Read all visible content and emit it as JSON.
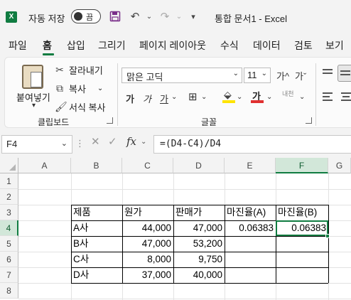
{
  "titlebar": {
    "app_logo": "X",
    "autosave_label": "자동 저장",
    "autosave_state": "끔",
    "save_icon": "save-icon",
    "undo_icon": "undo-icon",
    "redo_icon": "redo-icon",
    "customize_icon": "customize-qat-icon",
    "doc_title": "통합 문서1 - Excel"
  },
  "tabs": [
    {
      "label": "파일"
    },
    {
      "label": "홈"
    },
    {
      "label": "삽입"
    },
    {
      "label": "그리기"
    },
    {
      "label": "페이지 레이아웃"
    },
    {
      "label": "수식"
    },
    {
      "label": "데이터"
    },
    {
      "label": "검토"
    },
    {
      "label": "보기"
    }
  ],
  "clipboard": {
    "paste_label": "붙여넣기",
    "cut_label": "잘라내기",
    "copy_label": "복사",
    "format_painter_label": "서식 복사",
    "group_label": "클립보드"
  },
  "font": {
    "name": "맑은 고딕",
    "size": "11",
    "grow_label": "가^",
    "shrink_label": "가ˇ",
    "bold_label": "가",
    "italic_label": "가",
    "underline_label": "가",
    "color_label": "가",
    "phonetic_label": "내천",
    "group_label": "글꼴",
    "font_color_hex": "#e03030",
    "fill_color_hex": "#ffe400"
  },
  "formula_bar": {
    "name_box": "F4",
    "cancel_icon": "cancel-icon",
    "enter_icon": "enter-icon",
    "fx_label": "fx",
    "formula": "=(D4-C4)/D4"
  },
  "grid": {
    "columns": [
      "A",
      "B",
      "C",
      "D",
      "E",
      "F",
      "G"
    ],
    "rows": [
      "1",
      "2",
      "3",
      "4",
      "5",
      "6",
      "7",
      "8"
    ],
    "selected_column": "F",
    "selected_row": "4",
    "table": {
      "headers": [
        "제품",
        "원가",
        "판매가",
        "마진율(A)",
        "마진율(B)"
      ],
      "rows": [
        [
          "A사",
          "44,000",
          "47,000",
          "0.06383",
          "0.06383"
        ],
        [
          "B사",
          "47,000",
          "53,200",
          "",
          ""
        ],
        [
          "C사",
          "8,000",
          "9,750",
          "",
          ""
        ],
        [
          "D사",
          "37,000",
          "40,000",
          "",
          ""
        ]
      ]
    }
  },
  "colors": {
    "accent": "#107c41",
    "selected_header_bg": "#d2e7d9"
  }
}
